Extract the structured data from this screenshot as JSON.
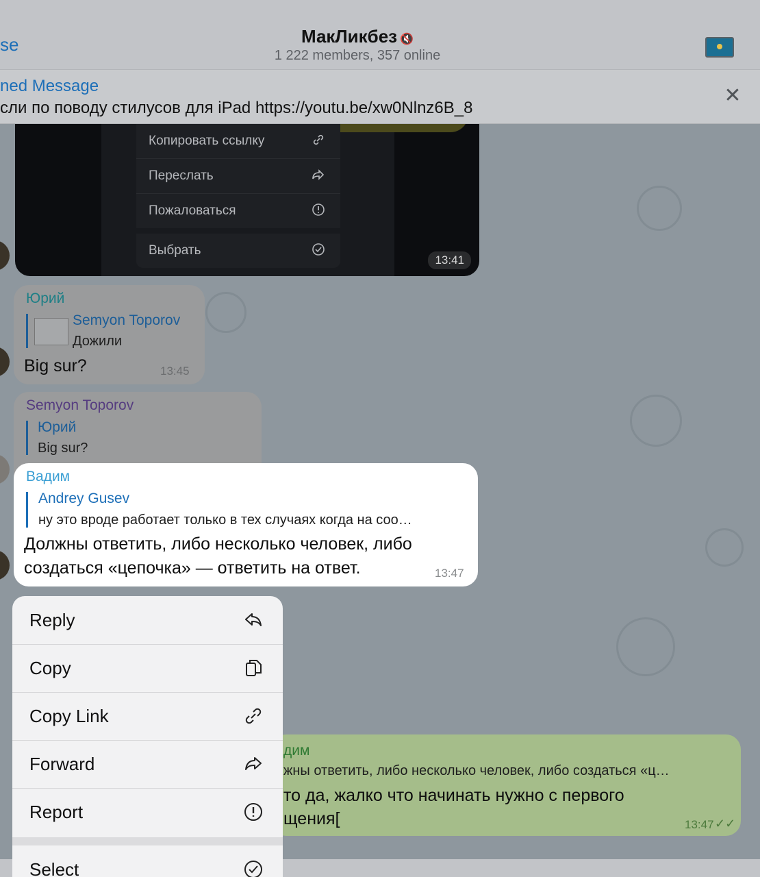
{
  "header": {
    "back_label": "se",
    "title": "МакЛикбез",
    "mute_glyph": "🔇",
    "subtitle": "1 222 members, 357 online",
    "avatar": "kazakhstan-flag-avatar"
  },
  "pinned": {
    "label": "ned Message",
    "text": "сли по поводу стилусов для iPad https://youtu.be/xw0Nlnz6B_8"
  },
  "media_message": {
    "menu_items": [
      "Копировать ссылку",
      "Переслать",
      "Пожаловаться",
      "Выбрать"
    ],
    "time": "13:41"
  },
  "messages": [
    {
      "sender": "Юрий",
      "reply_name": "Semyon Toporov",
      "reply_text": "Дожили",
      "text": "Big sur?",
      "time": "13:45"
    },
    {
      "sender": "Semyon Toporov",
      "reply_name": "Юрий",
      "reply_text": "Big sur?"
    }
  ],
  "focused_message": {
    "sender": "Вадим",
    "reply_name": "Andrey Gusev",
    "reply_text": "ну это вроде работает только в тех случаях когда на соо…",
    "text_line1": "Должны ответить, либо несколько человек, либо",
    "text_line2": "создаться «цепочка» — ответить на ответ.",
    "time": "13:47"
  },
  "own_message": {
    "reply_name": "дим",
    "reply_text": "жны ответить, либо несколько человек, либо создаться «ц…",
    "text_line1": "то да, жалко что начинать нужно с первого",
    "text_line2": "щения[",
    "time": "13:47"
  },
  "context_menu": {
    "items": [
      {
        "label": "Reply",
        "icon": "reply-icon"
      },
      {
        "label": "Copy",
        "icon": "copy-icon"
      },
      {
        "label": "Copy Link",
        "icon": "link-icon"
      },
      {
        "label": "Forward",
        "icon": "forward-icon"
      },
      {
        "label": "Report",
        "icon": "report-icon"
      },
      {
        "label": "Select",
        "icon": "select-check-icon"
      }
    ]
  },
  "colors": {
    "accent_blue": "#1d6fb8",
    "sender_teal": "#1f9aa6",
    "sender_purple": "#7a54b5",
    "sender_lightblue": "#3b9fd4",
    "own_bubble": "#a5bd8a"
  }
}
